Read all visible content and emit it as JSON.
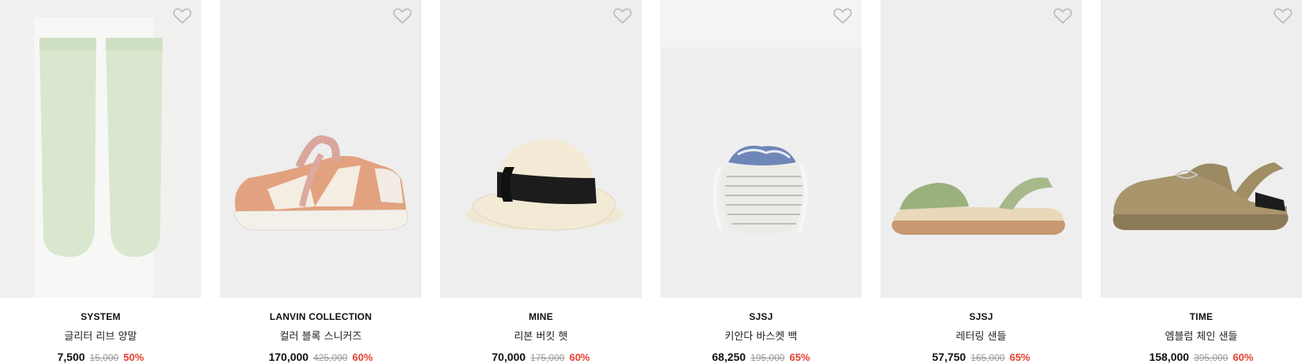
{
  "products": [
    {
      "brand": "SYSTEM",
      "name": "글리터 리브 양말",
      "price": "7,500",
      "original_price": "15,000",
      "discount": "50%",
      "image_icon": "socks-image",
      "wishlist_icon": "heart-outline-icon"
    },
    {
      "brand": "LANVIN COLLECTION",
      "name": "컬러 블록 스니커즈",
      "price": "170,000",
      "original_price": "425,000",
      "discount": "60%",
      "image_icon": "sneaker-image",
      "wishlist_icon": "heart-outline-icon"
    },
    {
      "brand": "MINE",
      "name": "리본 버킷 햇",
      "price": "70,000",
      "original_price": "175,000",
      "discount": "60%",
      "image_icon": "bucket-hat-image",
      "wishlist_icon": "heart-outline-icon"
    },
    {
      "brand": "SJSJ",
      "name": "키안다 바스켓 백",
      "price": "68,250",
      "original_price": "195,000",
      "discount": "65%",
      "image_icon": "basket-bag-image",
      "wishlist_icon": "heart-outline-icon"
    },
    {
      "brand": "SJSJ",
      "name": "레터링 샌들",
      "price": "57,750",
      "original_price": "165,000",
      "discount": "65%",
      "image_icon": "sandal-image",
      "wishlist_icon": "heart-outline-icon"
    },
    {
      "brand": "TIME",
      "name": "엠블럼 체인 샌들",
      "price": "158,000",
      "original_price": "395,000",
      "discount": "60%",
      "image_icon": "slingback-mule-image",
      "wishlist_icon": "heart-outline-icon"
    }
  ],
  "colors": {
    "discount": "#e4402f",
    "original_price": "#9a9a9a",
    "thumbnail_bg": "#eeeeee"
  }
}
